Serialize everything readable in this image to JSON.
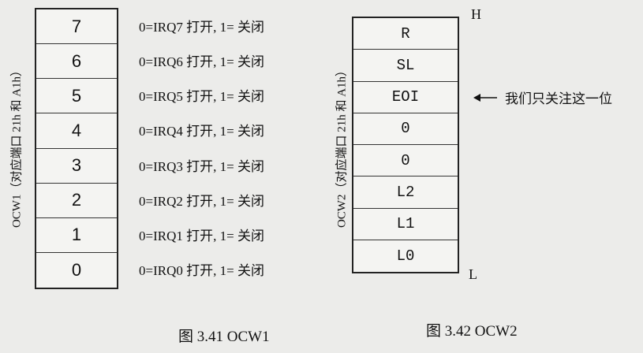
{
  "ocw1": {
    "bits": [
      "7",
      "6",
      "5",
      "4",
      "3",
      "2",
      "1",
      "0"
    ],
    "descriptions": [
      "0=IRQ7 打开, 1= 关闭",
      "0=IRQ6 打开, 1= 关闭",
      "0=IRQ5 打开, 1= 关闭",
      "0=IRQ4 打开, 1= 关闭",
      "0=IRQ3 打开, 1= 关闭",
      "0=IRQ2 打开, 1= 关闭",
      "0=IRQ1 打开, 1= 关闭",
      "0=IRQ0 打开, 1= 关闭"
    ],
    "side_label": "OCW1（对应端口 21h 和 A1h）",
    "caption": "图 3.41 OCW1"
  },
  "ocw2": {
    "bits": [
      "R",
      "SL",
      "EOI",
      "0",
      "0",
      "L2",
      "L1",
      "L0"
    ],
    "side_label": "OCW2（对应端口 21h 和 A1h）",
    "high": "H",
    "low": "L",
    "annotation": "我们只关注这一位",
    "caption": "图 3.42 OCW2"
  }
}
